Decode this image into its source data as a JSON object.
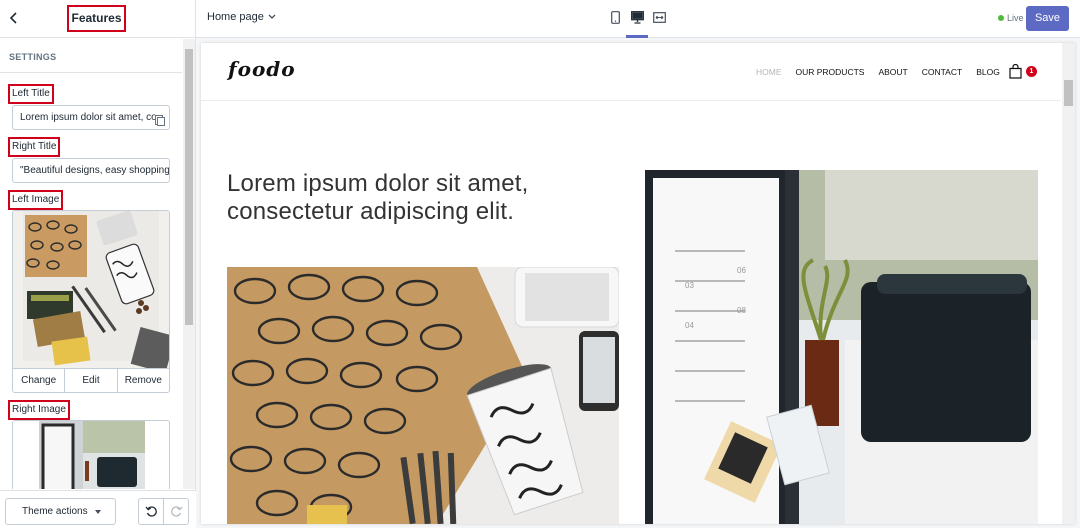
{
  "sidebar": {
    "title": "Features",
    "section": "SETTINGS",
    "left_title_label": "Left Title",
    "left_title_value": "Lorem ipsum dolor sit amet, con",
    "right_title_label": "Right Title",
    "right_title_value": "\"Beautiful designs, easy shopping",
    "left_image_label": "Left Image",
    "right_image_label": "Right Image",
    "image_actions": {
      "change": "Change",
      "edit": "Edit",
      "remove": "Remove"
    },
    "theme_actions": "Theme actions"
  },
  "topbar": {
    "page": "Home page",
    "devices": [
      "mobile-icon",
      "desktop-icon",
      "fullscreen-icon"
    ],
    "active_device": "desktop",
    "status": "Live",
    "save": "Save",
    "accent": "#5c6ac4",
    "live_color": "#50b83c"
  },
  "preview": {
    "logo": "foodo",
    "nav": [
      "HOME",
      "OUR PRODUCTS",
      "ABOUT",
      "CONTACT",
      "BLOG"
    ],
    "cart_count": "1",
    "hero_line1": "Lorem ipsum dolor sit amet,",
    "hero_line2": "consectetur adipiscing elit.",
    "highlight_color": "#d0021b"
  }
}
